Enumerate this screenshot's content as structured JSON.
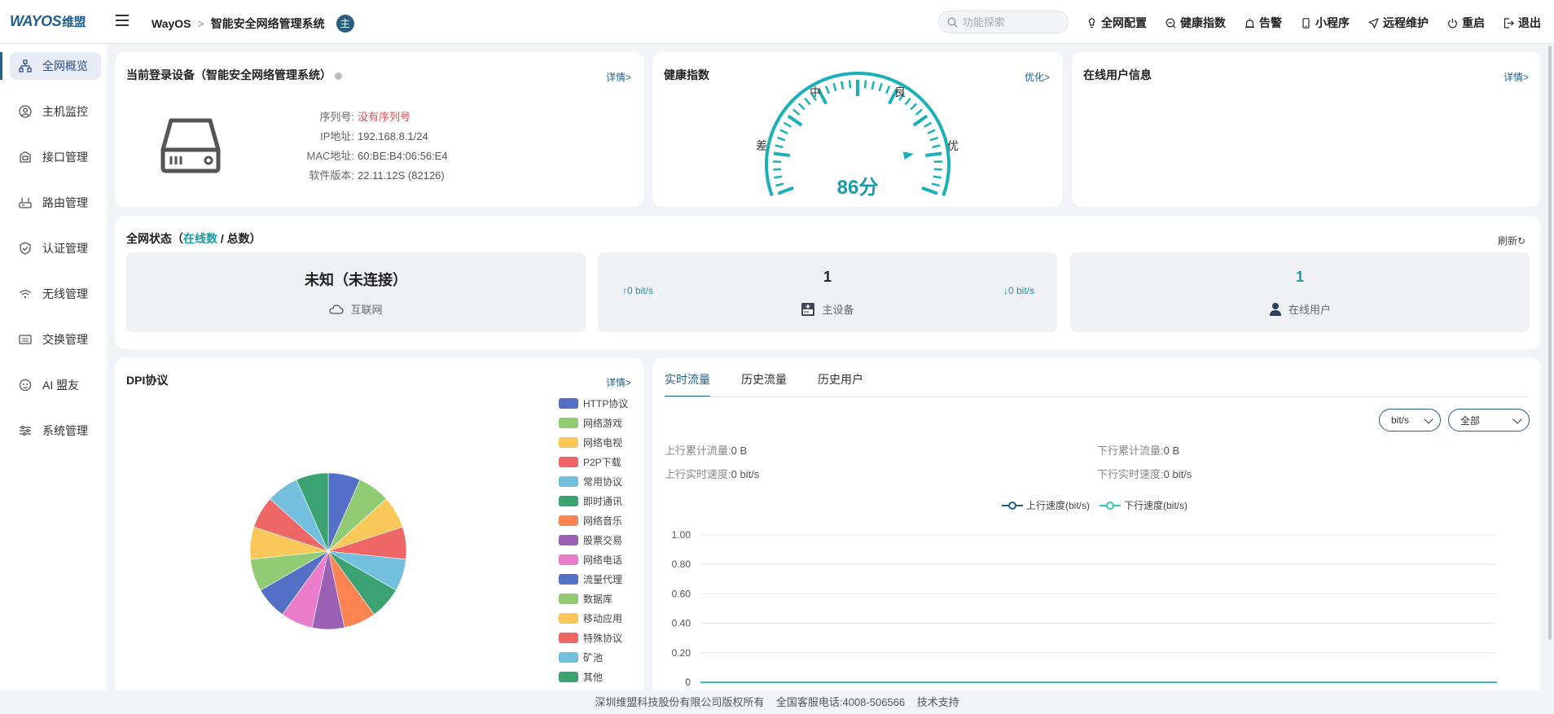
{
  "header": {
    "logo": "WAYOS",
    "logo_cn": "维盟",
    "breadcrumb_root": "WayOS",
    "breadcrumb_page": "智能安全网络管理系统",
    "badge": "主",
    "search_placeholder": "功能探索",
    "actions": [
      {
        "label": "全网配置",
        "icon": "bulb-icon"
      },
      {
        "label": "健康指数",
        "icon": "health-icon"
      },
      {
        "label": "告警",
        "icon": "alarm-icon"
      },
      {
        "label": "小程序",
        "icon": "phone-icon"
      },
      {
        "label": "远程维护",
        "icon": "send-icon"
      },
      {
        "label": "重启",
        "icon": "power-icon"
      },
      {
        "label": "退出",
        "icon": "logout-icon"
      }
    ]
  },
  "sidebar": {
    "items": [
      {
        "label": "全网概览",
        "icon": "network-icon",
        "active": true
      },
      {
        "label": "主机监控",
        "icon": "user-circle-icon"
      },
      {
        "label": "接口管理",
        "icon": "interface-icon"
      },
      {
        "label": "路由管理",
        "icon": "router-icon"
      },
      {
        "label": "认证管理",
        "icon": "shield-icon"
      },
      {
        "label": "无线管理",
        "icon": "wifi-icon"
      },
      {
        "label": "交换管理",
        "icon": "switch-icon"
      },
      {
        "label": "AI 盟友",
        "icon": "ai-icon"
      },
      {
        "label": "系统管理",
        "icon": "sliders-icon"
      }
    ]
  },
  "device_card": {
    "title": "当前登录设备（智能安全网络管理系统）",
    "link": "详情>",
    "rows": [
      {
        "key": "序列号:",
        "value": "没有序列号",
        "warn": true
      },
      {
        "key": "IP地址:",
        "value": "192.168.8.1/24"
      },
      {
        "key": "MAC地址:",
        "value": "60:BE:B4:06:56:E4"
      },
      {
        "key": "软件版本:",
        "value": "22.11.12S (82126)"
      }
    ]
  },
  "health_card": {
    "title": "健康指数",
    "link": "优化>",
    "labels": [
      "差",
      "中",
      "良",
      "优"
    ],
    "score": "86分",
    "score_value": 86,
    "accent": "#1ab0b8"
  },
  "online_card": {
    "title": "在线用户信息",
    "link": "详情>"
  },
  "status_card": {
    "title_prefix": "全网状态（",
    "title_online": "在线数",
    "title_mid": " / ",
    "title_total": "总数",
    "title_suffix": "）",
    "refresh": "刷新",
    "boxes": {
      "internet": {
        "main": "未知（未连接）",
        "sub": "互联网"
      },
      "device": {
        "main": "1",
        "sub": "主设备",
        "up": "↑0 bit/s",
        "down": "↓0 bit/s"
      },
      "users": {
        "main": "1",
        "sub": "在线用户"
      }
    }
  },
  "dpi_card": {
    "title": "DPI协议",
    "link": "详情>"
  },
  "traffic_card": {
    "tabs": [
      "实时流量",
      "历史流量",
      "历史用户"
    ],
    "unit_select": "bit/s",
    "scope_select": "全部",
    "up_total_label": "上行累计流量:",
    "up_total": "0 B",
    "down_total_label": "下行累计流量:",
    "down_total": "0 B",
    "up_speed_label": "上行实时速度:",
    "up_speed": "0 bit/s",
    "down_speed_label": "下行实时速度:",
    "down_speed": "0 bit/s"
  },
  "footer": {
    "copyright": "深圳维盟科技股份有限公司版权所有",
    "hotline": "全国客服电话:4008-506566",
    "support": "技术支持"
  },
  "chart_data": [
    {
      "type": "pie",
      "categories": [
        "HTTP协议",
        "网络游戏",
        "网络电视",
        "P2P下载",
        "常用协议",
        "即时通讯",
        "网络音乐",
        "股票交易",
        "网络电话",
        "流量代理",
        "数据库",
        "移动应用",
        "特殊协议",
        "矿池",
        "其他"
      ],
      "colors": [
        "#5470c6",
        "#91cc75",
        "#fac858",
        "#ee6666",
        "#73c0de",
        "#3ba272",
        "#fc8452",
        "#9a60b4",
        "#ea7ccc",
        "#5470c6",
        "#91cc75",
        "#fac858",
        "#ee6666",
        "#73c0de",
        "#3ba272"
      ],
      "values": [
        1,
        1,
        1,
        1,
        1,
        1,
        1,
        1,
        1,
        1,
        1,
        1,
        1,
        1,
        1
      ]
    },
    {
      "type": "line",
      "series": [
        {
          "name": "上行速度(bit/s)",
          "color": "#1f5f8b",
          "values": [
            0,
            0,
            0,
            0,
            0,
            0,
            0,
            0,
            0,
            0,
            0,
            0,
            0,
            0,
            0,
            0
          ]
        },
        {
          "name": "下行速度(bit/s)",
          "color": "#36c2b4",
          "values": [
            0,
            0,
            0,
            0,
            0,
            0,
            0,
            0,
            0,
            0,
            0,
            0,
            0,
            0,
            0,
            0
          ]
        }
      ],
      "y_ticks": [
        "1.00",
        "0.80",
        "0.60",
        "0.40",
        "0.20",
        "0"
      ],
      "ylim": [
        0,
        1
      ]
    }
  ]
}
